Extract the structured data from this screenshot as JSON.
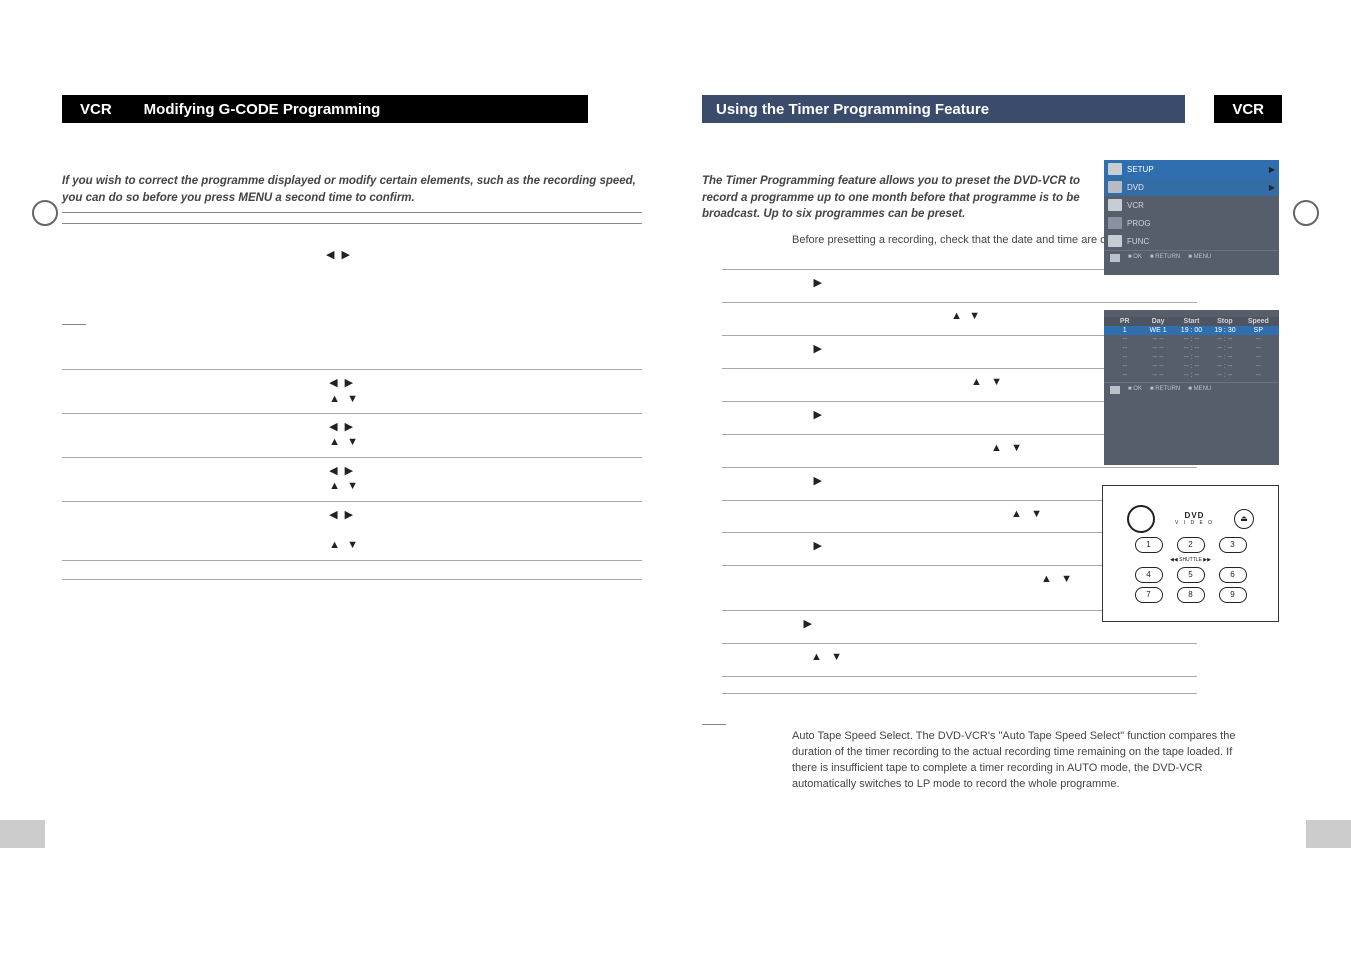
{
  "left": {
    "vcr": "VCR",
    "title": "Modifying G-CODE Programming",
    "intro": "If you wish to correct the programme displayed or modify certain elements, such as the recording speed, you can do so before you press MENU a second time to confirm.",
    "note_bottom": ""
  },
  "right": {
    "title": "Using the Timer Programming Feature",
    "vcr": "VCR",
    "intro": "The Timer Programming feature allows you to preset the DVD-VCR to record a programme up to one month before that programme is to be broadcast. Up to six programmes can be preset.",
    "check": "Before presetting a recording, check that the date and time are correct.",
    "auto_note": "Auto Tape Speed Select. The DVD-VCR's \"Auto Tape Speed Select\" function compares the duration of the timer recording to the actual recording time remaining on the tape loaded. If there is insufficient tape to complete a timer recording in AUTO mode, the DVD-VCR automatically switches to LP mode to record the whole programme."
  },
  "osd_a": {
    "items": [
      "SETUP",
      "DVD",
      "VCR",
      "PROG",
      "FUNC"
    ],
    "foot": [
      "OK",
      "RETURN",
      "MENU"
    ]
  },
  "osd_b": {
    "head": [
      "PR",
      "Day",
      "Start",
      "Stop",
      "Speed"
    ],
    "row1": [
      "1",
      "WE  1",
      "19 : 00",
      "19 : 30",
      "SP"
    ],
    "blank": [
      "--",
      "-- --",
      "-- : --",
      "-- : --",
      "--"
    ],
    "foot": [
      "OK",
      "RETURN",
      "MENU"
    ]
  },
  "remote": {
    "dvd": "DVD",
    "shuttle": "SHUTTLE",
    "keys": [
      "1",
      "2",
      "3",
      "4",
      "5",
      "6",
      "7",
      "8",
      "9"
    ]
  }
}
